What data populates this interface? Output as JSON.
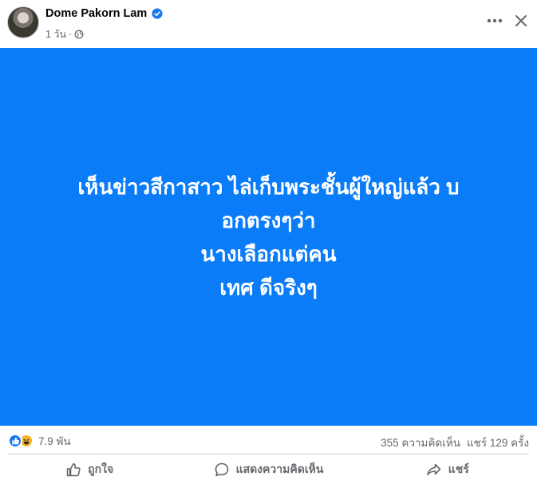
{
  "post": {
    "author": "Dome Pakorn Lam",
    "time": "1 วัน",
    "separator": "·",
    "lines": [
      "เห็นข่าวสีกาสาว ไล่เก็บพระชั้นผู้ใหญ่แล้ว บ",
      "อกตรงๆว่า",
      "นางเลือกแต่คน",
      "เทศ ดีจริงๆ"
    ],
    "background_color": "#0b7cf8"
  },
  "stats": {
    "reaction_count": "7.9 พัน",
    "comments": "355 ความคิดเห็น",
    "shares": "แชร์ 129 ครั้ง"
  },
  "actions": {
    "like": "ถูกใจ",
    "comment": "แสดงความคิดเห็น",
    "share": "แชร์"
  }
}
